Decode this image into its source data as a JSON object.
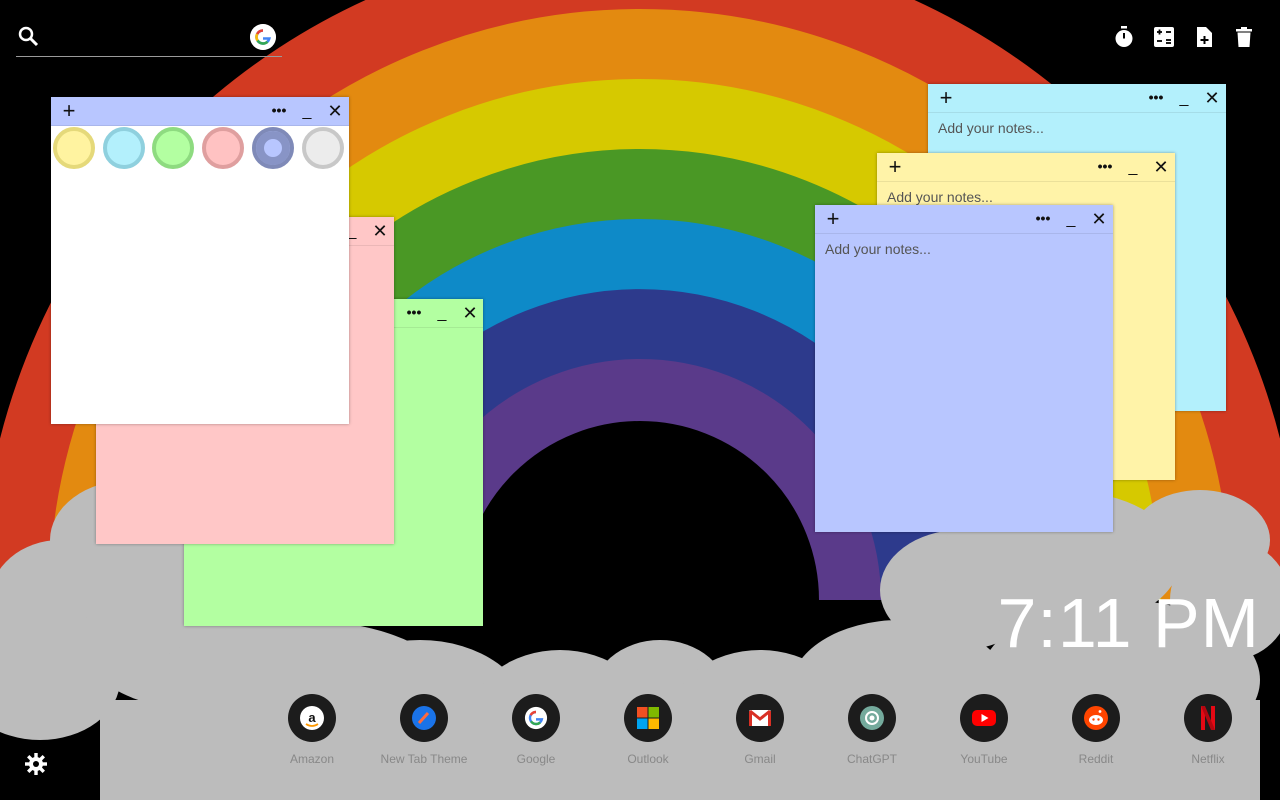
{
  "search": {
    "placeholder": ""
  },
  "toolbar": {
    "timer_icon": "timer-icon",
    "calculator_icon": "calculator-icon",
    "new_note_icon": "new-note-icon",
    "delete_icon": "trash-icon"
  },
  "notes": {
    "placeholder": "Add your notes...",
    "add_symbol": "+",
    "more_symbol": "•••",
    "min_symbol": "_",
    "close_symbol": "✕",
    "colors": [
      "#ffeb99",
      "#b3f0ff",
      "#b3ffa8",
      "#ffc7c7",
      "#b3c2ff",
      "#ececec"
    ]
  },
  "clock": {
    "time": "7:11 PM"
  },
  "shortcuts": [
    {
      "label": "Amazon",
      "icon": "amazon-icon"
    },
    {
      "label": "New Tab Theme",
      "icon": "new-tab-theme-icon"
    },
    {
      "label": "Google",
      "icon": "google-icon"
    },
    {
      "label": "Outlook",
      "icon": "outlook-icon"
    },
    {
      "label": "Gmail",
      "icon": "gmail-icon"
    },
    {
      "label": "ChatGPT",
      "icon": "chatgpt-icon"
    },
    {
      "label": "YouTube",
      "icon": "youtube-icon"
    },
    {
      "label": "Reddit",
      "icon": "reddit-icon"
    },
    {
      "label": "Netflix",
      "icon": "netflix-icon"
    }
  ],
  "settings": {
    "icon": "gear-icon"
  }
}
